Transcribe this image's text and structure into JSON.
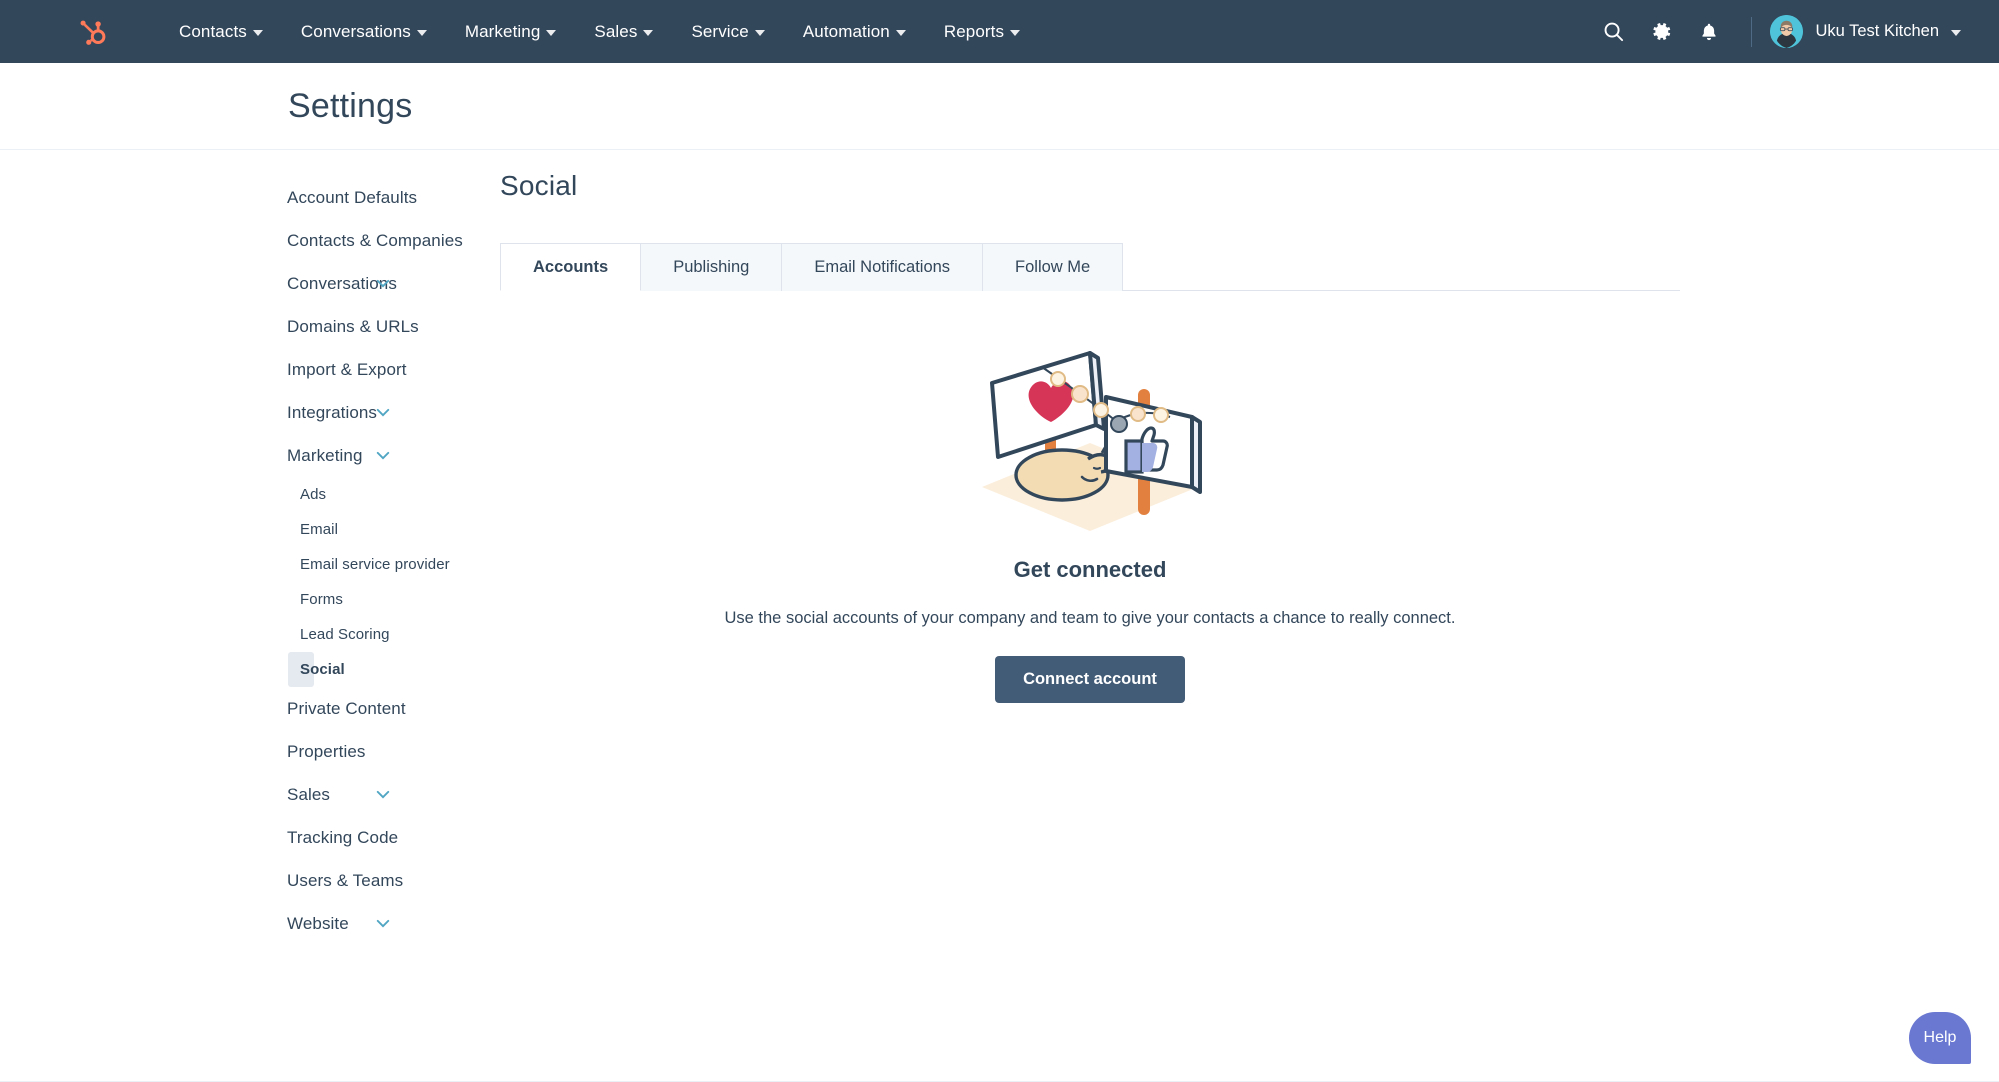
{
  "topnav": {
    "logo_icon": "hubspot-sprocket-logo",
    "brand_color": "#ff7a59",
    "background_color": "#33475b",
    "menu": [
      {
        "label": "Contacts",
        "has_caret": true
      },
      {
        "label": "Conversations",
        "has_caret": true
      },
      {
        "label": "Marketing",
        "has_caret": true
      },
      {
        "label": "Sales",
        "has_caret": true
      },
      {
        "label": "Service",
        "has_caret": true
      },
      {
        "label": "Automation",
        "has_caret": true
      },
      {
        "label": "Reports",
        "has_caret": true
      }
    ],
    "icons": [
      {
        "name": "search-icon"
      },
      {
        "name": "gear-icon"
      },
      {
        "name": "bell-icon"
      }
    ],
    "user": {
      "name": "Uku Test Kitchen",
      "avatar_alt": "user-avatar",
      "avatar_bg": "#4fc3d9",
      "has_caret": true
    }
  },
  "page": {
    "title": "Settings"
  },
  "sidebar": {
    "items": [
      {
        "label": "Account Defaults",
        "expandable": false,
        "active": false,
        "sub": false
      },
      {
        "label": "Contacts & Companies",
        "expandable": false,
        "active": false,
        "sub": false
      },
      {
        "label": "Conversations",
        "expandable": true,
        "active": false,
        "sub": false
      },
      {
        "label": "Domains & URLs",
        "expandable": false,
        "active": false,
        "sub": false
      },
      {
        "label": "Import & Export",
        "expandable": false,
        "active": false,
        "sub": false
      },
      {
        "label": "Integrations",
        "expandable": true,
        "active": false,
        "sub": false
      },
      {
        "label": "Marketing",
        "expandable": true,
        "active": false,
        "sub": false
      },
      {
        "label": "Ads",
        "expandable": false,
        "active": false,
        "sub": true
      },
      {
        "label": "Email",
        "expandable": false,
        "active": false,
        "sub": true
      },
      {
        "label": "Email service provider",
        "expandable": false,
        "active": false,
        "sub": true
      },
      {
        "label": "Forms",
        "expandable": false,
        "active": false,
        "sub": true
      },
      {
        "label": "Lead Scoring",
        "expandable": false,
        "active": false,
        "sub": true
      },
      {
        "label": "Social",
        "expandable": false,
        "active": true,
        "sub": true
      },
      {
        "label": "Private Content",
        "expandable": false,
        "active": false,
        "sub": false
      },
      {
        "label": "Properties",
        "expandable": false,
        "active": false,
        "sub": false
      },
      {
        "label": "Sales",
        "expandable": true,
        "active": false,
        "sub": false
      },
      {
        "label": "Tracking Code",
        "expandable": false,
        "active": false,
        "sub": false
      },
      {
        "label": "Users & Teams",
        "expandable": false,
        "active": false,
        "sub": false
      },
      {
        "label": "Website",
        "expandable": true,
        "active": false,
        "sub": false
      }
    ]
  },
  "main": {
    "section_title": "Social",
    "tabs": [
      {
        "label": "Accounts",
        "active": true
      },
      {
        "label": "Publishing",
        "active": false
      },
      {
        "label": "Email Notifications",
        "active": false
      },
      {
        "label": "Follow Me",
        "active": false
      }
    ],
    "empty_state": {
      "illustration_name": "social-signs-illustration",
      "heading": "Get connected",
      "subtext": "Use the social accounts of your company and team to give your contacts a chance to really connect.",
      "button_label": "Connect account",
      "button_color": "#425b76"
    }
  },
  "help": {
    "label": "Help",
    "color": "#6a78d1"
  }
}
